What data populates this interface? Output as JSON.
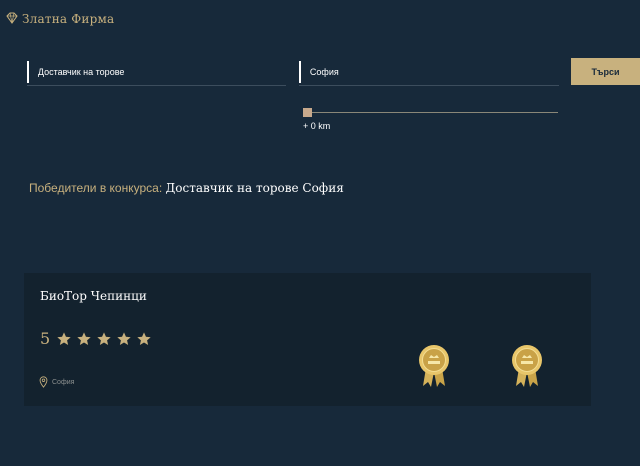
{
  "brand": {
    "name": "Златна Фирма",
    "icon": "diamond-icon",
    "color": "#c8b17e"
  },
  "search": {
    "keyword_value": "Доставчик на торове",
    "city_value": "София",
    "button_label": "Търси",
    "distance_label": "+ 0 km",
    "distance_km": 0
  },
  "winners": {
    "label": "Победители в конкурса:",
    "query": "Доставчик на торове София"
  },
  "results": [
    {
      "name": "БиоТор Чепинци",
      "rating": "5",
      "stars": 5,
      "location": "София",
      "badges": [
        "award-badge-icon",
        "award-badge-icon"
      ]
    }
  ],
  "colors": {
    "background": "#17293a",
    "card": "#13222e",
    "accent": "#c8b17e"
  }
}
